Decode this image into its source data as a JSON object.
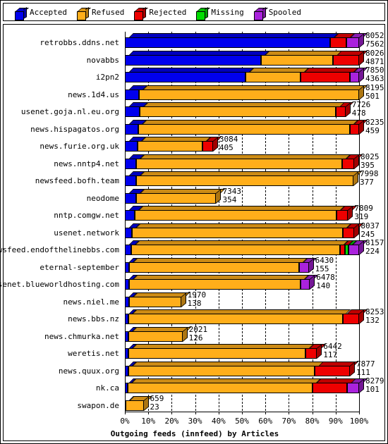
{
  "legend": {
    "items": [
      {
        "label": "Accepted",
        "color": "#0000ee",
        "icon": "cube-icon"
      },
      {
        "label": "Refused",
        "color": "#ffae1a",
        "icon": "cube-icon"
      },
      {
        "label": "Rejected",
        "color": "#ee0000",
        "icon": "cube-icon"
      },
      {
        "label": "Missing",
        "color": "#00dd00",
        "icon": "cube-icon"
      },
      {
        "label": "Spooled",
        "color": "#aa22dd",
        "icon": "cube-icon"
      }
    ]
  },
  "axis": {
    "title": "Outgoing feeds (innfeed) by Articles",
    "ticks": [
      "0%",
      "10%",
      "20%",
      "30%",
      "40%",
      "50%",
      "60%",
      "70%",
      "80%",
      "90%",
      "100%"
    ]
  },
  "chart_data": {
    "type": "bar",
    "orientation": "horizontal",
    "stacked": true,
    "normalized_percent": true,
    "title": "Outgoing feeds (innfeed) by Articles",
    "xlabel": "Outgoing feeds (innfeed) by Articles",
    "ylabel": "",
    "xlim": [
      0,
      100
    ],
    "xticks": [
      0,
      10,
      20,
      30,
      40,
      50,
      60,
      70,
      80,
      90,
      100
    ],
    "grid": true,
    "legend_position": "top",
    "series": [
      {
        "name": "Accepted",
        "color": "#0000ee"
      },
      {
        "name": "Refused",
        "color": "#ffae1a"
      },
      {
        "name": "Rejected",
        "color": "#ee0000"
      },
      {
        "name": "Missing",
        "color": "#00dd00"
      },
      {
        "name": "Spooled",
        "color": "#aa22dd"
      }
    ],
    "categories": [
      "retrobbs.ddns.net",
      "novabbs",
      "i2pn2",
      "news.1d4.us",
      "usenet.goja.nl.eu.org",
      "news.hispagatos.org",
      "news.furie.org.uk",
      "news.nntp4.net",
      "newsfeed.bofh.team",
      "neodome",
      "nntp.comgw.net",
      "usenet.network",
      "newsfeed.endofthelinebbs.com",
      "eternal-september",
      "usenet.blueworldhosting.com",
      "news.niel.me",
      "news.bbs.nz",
      "news.chmurka.net",
      "weretis.net",
      "news.quux.org",
      "nk.ca",
      "swapon.de"
    ],
    "rows": [
      {
        "label": "retrobbs.ddns.net",
        "value_top": "8052",
        "value_bottom": "7562",
        "total_pct": 100,
        "segments": [
          {
            "name": "Accepted",
            "pct": 87.5
          },
          {
            "name": "Refused",
            "pct": 0
          },
          {
            "name": "Rejected",
            "pct": 7.0
          },
          {
            "name": "Missing",
            "pct": 0
          },
          {
            "name": "Spooled",
            "pct": 5.5
          }
        ]
      },
      {
        "label": "novabbs",
        "value_top": "8026",
        "value_bottom": "4871",
        "total_pct": 100,
        "segments": [
          {
            "name": "Accepted",
            "pct": 58.0
          },
          {
            "name": "Refused",
            "pct": 31.0
          },
          {
            "name": "Rejected",
            "pct": 11.0
          },
          {
            "name": "Missing",
            "pct": 0
          },
          {
            "name": "Spooled",
            "pct": 0
          }
        ]
      },
      {
        "label": "i2pn2",
        "value_top": "7850",
        "value_bottom": "4363",
        "total_pct": 100,
        "segments": [
          {
            "name": "Accepted",
            "pct": 51.5
          },
          {
            "name": "Refused",
            "pct": 23.5
          },
          {
            "name": "Rejected",
            "pct": 21.0
          },
          {
            "name": "Missing",
            "pct": 0
          },
          {
            "name": "Spooled",
            "pct": 4.0
          }
        ]
      },
      {
        "label": "news.1d4.us",
        "value_top": "8195",
        "value_bottom": "501",
        "total_pct": 100,
        "segments": [
          {
            "name": "Accepted",
            "pct": 6.1
          },
          {
            "name": "Refused",
            "pct": 93.9
          },
          {
            "name": "Rejected",
            "pct": 0
          },
          {
            "name": "Missing",
            "pct": 0
          },
          {
            "name": "Spooled",
            "pct": 0
          }
        ]
      },
      {
        "label": "usenet.goja.nl.eu.org",
        "value_top": "7726",
        "value_bottom": "478",
        "total_pct": 94.2,
        "segments": [
          {
            "name": "Accepted",
            "pct": 6.2
          },
          {
            "name": "Refused",
            "pct": 84.0
          },
          {
            "name": "Rejected",
            "pct": 4.0
          },
          {
            "name": "Missing",
            "pct": 0
          },
          {
            "name": "Spooled",
            "pct": 0
          }
        ]
      },
      {
        "label": "news.hispagatos.org",
        "value_top": "8235",
        "value_bottom": "459",
        "total_pct": 100,
        "segments": [
          {
            "name": "Accepted",
            "pct": 5.6
          },
          {
            "name": "Refused",
            "pct": 90.4
          },
          {
            "name": "Rejected",
            "pct": 4.0
          },
          {
            "name": "Missing",
            "pct": 0
          },
          {
            "name": "Spooled",
            "pct": 0
          }
        ]
      },
      {
        "label": "news.furie.org.uk",
        "value_top": "3084",
        "value_bottom": "405",
        "total_pct": 37.6,
        "segments": [
          {
            "name": "Accepted",
            "pct": 5.5
          },
          {
            "name": "Refused",
            "pct": 27.6
          },
          {
            "name": "Rejected",
            "pct": 4.5
          },
          {
            "name": "Missing",
            "pct": 0
          },
          {
            "name": "Spooled",
            "pct": 0
          }
        ]
      },
      {
        "label": "news.nntp4.net",
        "value_top": "8025",
        "value_bottom": "395",
        "total_pct": 97.9,
        "segments": [
          {
            "name": "Accepted",
            "pct": 4.9
          },
          {
            "name": "Refused",
            "pct": 88.0
          },
          {
            "name": "Rejected",
            "pct": 5.0
          },
          {
            "name": "Missing",
            "pct": 0
          },
          {
            "name": "Spooled",
            "pct": 0
          }
        ]
      },
      {
        "label": "newsfeed.bofh.team",
        "value_top": "7998",
        "value_bottom": "377",
        "total_pct": 97.6,
        "segments": [
          {
            "name": "Accepted",
            "pct": 4.7
          },
          {
            "name": "Refused",
            "pct": 92.9
          },
          {
            "name": "Rejected",
            "pct": 0
          },
          {
            "name": "Missing",
            "pct": 0
          },
          {
            "name": "Spooled",
            "pct": 0
          }
        ]
      },
      {
        "label": "neodome",
        "value_top": "7343",
        "value_bottom": "354",
        "total_pct": 39.0,
        "segments": [
          {
            "name": "Accepted",
            "pct": 4.8
          },
          {
            "name": "Refused",
            "pct": 34.2
          },
          {
            "name": "Rejected",
            "pct": 0
          },
          {
            "name": "Missing",
            "pct": 0
          },
          {
            "name": "Spooled",
            "pct": 0
          }
        ]
      },
      {
        "label": "nntp.comgw.net",
        "value_top": "7809",
        "value_bottom": "319",
        "total_pct": 95.3,
        "segments": [
          {
            "name": "Accepted",
            "pct": 4.1
          },
          {
            "name": "Refused",
            "pct": 86.2
          },
          {
            "name": "Rejected",
            "pct": 5.0
          },
          {
            "name": "Missing",
            "pct": 0
          },
          {
            "name": "Spooled",
            "pct": 0
          }
        ]
      },
      {
        "label": "usenet.network",
        "value_top": "8037",
        "value_bottom": "245",
        "total_pct": 98.0,
        "segments": [
          {
            "name": "Accepted",
            "pct": 3.0
          },
          {
            "name": "Refused",
            "pct": 90.0
          },
          {
            "name": "Rejected",
            "pct": 5.0
          },
          {
            "name": "Missing",
            "pct": 0
          },
          {
            "name": "Spooled",
            "pct": 0
          }
        ]
      },
      {
        "label": "newsfeed.endofthelinebbs.com",
        "value_top": "8157",
        "value_bottom": "224",
        "total_pct": 100,
        "segments": [
          {
            "name": "Accepted",
            "pct": 2.7
          },
          {
            "name": "Refused",
            "pct": 89.3
          },
          {
            "name": "Rejected",
            "pct": 2.0
          },
          {
            "name": "Missing",
            "pct": 1.5
          },
          {
            "name": "Spooled",
            "pct": 4.5
          }
        ]
      },
      {
        "label": "eternal-september",
        "value_top": "6430",
        "value_bottom": "155",
        "total_pct": 78.5,
        "segments": [
          {
            "name": "Accepted",
            "pct": 1.9
          },
          {
            "name": "Refused",
            "pct": 72.6
          },
          {
            "name": "Rejected",
            "pct": 0
          },
          {
            "name": "Missing",
            "pct": 0
          },
          {
            "name": "Spooled",
            "pct": 4.0
          }
        ]
      },
      {
        "label": "usenet.blueworldhosting.com",
        "value_top": "6478",
        "value_bottom": "140",
        "total_pct": 79.0,
        "segments": [
          {
            "name": "Accepted",
            "pct": 1.7
          },
          {
            "name": "Refused",
            "pct": 73.3
          },
          {
            "name": "Rejected",
            "pct": 0
          },
          {
            "name": "Missing",
            "pct": 0
          },
          {
            "name": "Spooled",
            "pct": 4.0
          }
        ]
      },
      {
        "label": "news.niel.me",
        "value_top": "1970",
        "value_bottom": "138",
        "total_pct": 24.0,
        "segments": [
          {
            "name": "Accepted",
            "pct": 1.7
          },
          {
            "name": "Refused",
            "pct": 22.3
          },
          {
            "name": "Rejected",
            "pct": 0
          },
          {
            "name": "Missing",
            "pct": 0
          },
          {
            "name": "Spooled",
            "pct": 0
          }
        ]
      },
      {
        "label": "news.bbs.nz",
        "value_top": "8253",
        "value_bottom": "132",
        "total_pct": 100,
        "segments": [
          {
            "name": "Accepted",
            "pct": 1.6
          },
          {
            "name": "Refused",
            "pct": 91.4
          },
          {
            "name": "Rejected",
            "pct": 7.0
          },
          {
            "name": "Missing",
            "pct": 0
          },
          {
            "name": "Spooled",
            "pct": 0
          }
        ]
      },
      {
        "label": "news.chmurka.net",
        "value_top": "2021",
        "value_bottom": "126",
        "total_pct": 24.6,
        "segments": [
          {
            "name": "Accepted",
            "pct": 1.5
          },
          {
            "name": "Refused",
            "pct": 23.1
          },
          {
            "name": "Rejected",
            "pct": 0
          },
          {
            "name": "Missing",
            "pct": 0
          },
          {
            "name": "Spooled",
            "pct": 0
          }
        ]
      },
      {
        "label": "weretis.net",
        "value_top": "6442",
        "value_bottom": "117",
        "total_pct": 82.0,
        "segments": [
          {
            "name": "Accepted",
            "pct": 1.4
          },
          {
            "name": "Refused",
            "pct": 75.6
          },
          {
            "name": "Rejected",
            "pct": 5.0
          },
          {
            "name": "Missing",
            "pct": 0
          },
          {
            "name": "Spooled",
            "pct": 0
          }
        ]
      },
      {
        "label": "news.quux.org",
        "value_top": "7877",
        "value_bottom": "111",
        "total_pct": 96.1,
        "segments": [
          {
            "name": "Accepted",
            "pct": 1.4
          },
          {
            "name": "Refused",
            "pct": 79.7
          },
          {
            "name": "Rejected",
            "pct": 15.0
          },
          {
            "name": "Missing",
            "pct": 0
          },
          {
            "name": "Spooled",
            "pct": 0
          }
        ]
      },
      {
        "label": "nk.ca",
        "value_top": "8279",
        "value_bottom": "101",
        "total_pct": 100,
        "segments": [
          {
            "name": "Accepted",
            "pct": 1.2
          },
          {
            "name": "Refused",
            "pct": 78.8
          },
          {
            "name": "Rejected",
            "pct": 15.0
          },
          {
            "name": "Missing",
            "pct": 0
          },
          {
            "name": "Spooled",
            "pct": 5.0
          }
        ]
      },
      {
        "label": "swapon.de",
        "value_top": "659",
        "value_bottom": "23",
        "total_pct": 8.0,
        "segments": [
          {
            "name": "Accepted",
            "pct": 0.3
          },
          {
            "name": "Refused",
            "pct": 7.7
          },
          {
            "name": "Rejected",
            "pct": 0
          },
          {
            "name": "Missing",
            "pct": 0
          },
          {
            "name": "Spooled",
            "pct": 0
          }
        ]
      }
    ]
  }
}
